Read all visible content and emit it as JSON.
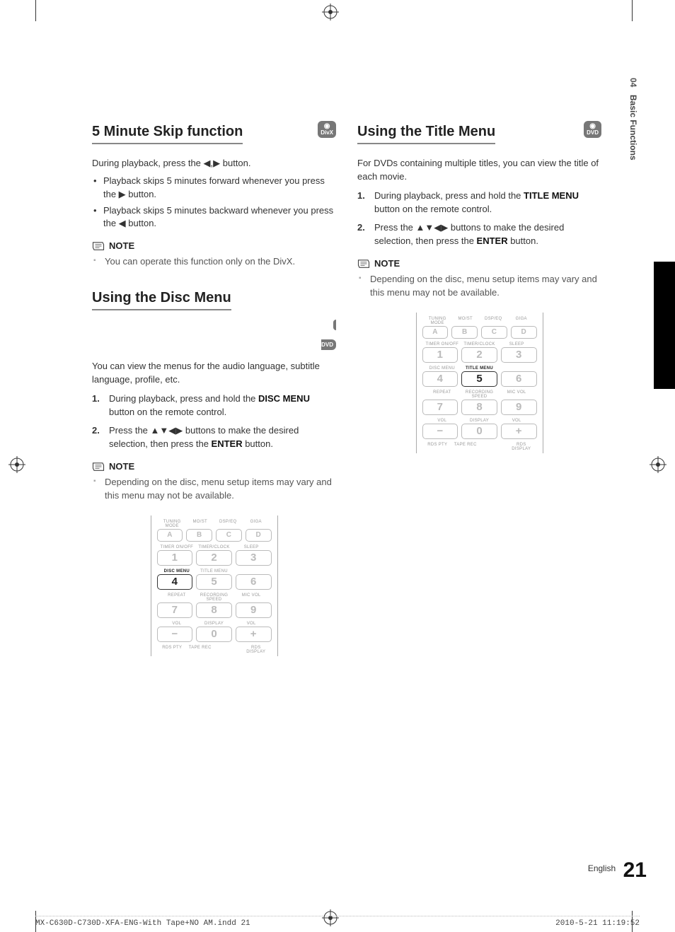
{
  "chapter": {
    "number": "04",
    "title": "Basic Functions"
  },
  "footer": {
    "language": "English",
    "page_number": "21"
  },
  "indd": {
    "file": "MX-C630D-C730D-XFA-ENG-With Tape+NO AM.indd   21",
    "timestamp": "2010-5-21   11:19:52"
  },
  "col_left": {
    "s1": {
      "heading": "5 Minute Skip function",
      "badge": "DivX",
      "intro": "During playback, press the ◀,▶ button.",
      "bullets": [
        "Playback skips 5 minutes forward whenever you press the ▶ button.",
        "Playback skips 5 minutes backward whenever you press the ◀ button."
      ],
      "note_label": "NOTE",
      "notes": [
        "You can operate this function only on the DivX."
      ]
    },
    "s2": {
      "heading": "Using the Disc Menu",
      "badge": "DVD",
      "intro": "You can view the menus for the audio language, subtitle language, profile, etc.",
      "steps": [
        {
          "n": "1.",
          "html": "During playback, press and hold the <b>DISC MENU</b> button on the remote control."
        },
        {
          "n": "2.",
          "html": "Press the ▲▼◀▶ buttons to make the desired selection, then press the <b>ENTER</b> button."
        }
      ],
      "note_label": "NOTE",
      "notes": [
        "Depending on the disc, menu setup items may vary and this menu may not be available."
      ],
      "remote_highlight": {
        "label": "DISC MENU",
        "digit": "4"
      }
    }
  },
  "col_right": {
    "s1": {
      "heading": "Using the Title Menu",
      "badge": "DVD",
      "intro": "For DVDs containing multiple titles, you can view the title of each movie.",
      "steps": [
        {
          "n": "1.",
          "html": "During playback, press and hold the <b>TITLE MENU</b> button on the remote control."
        },
        {
          "n": "2.",
          "html": "Press the ▲▼◀▶ buttons to make the desired selection, then press the <b>ENTER</b> button."
        }
      ],
      "note_label": "NOTE",
      "notes": [
        "Depending on the disc, menu setup items may vary and this menu may not be available."
      ],
      "remote_highlight": {
        "label": "TITLE MENU",
        "digit": "5"
      }
    }
  },
  "remote": {
    "row_a_labels": [
      "TUNING MODE",
      "MO/ST",
      "DSP/EQ",
      "GIGA"
    ],
    "row_a": [
      "A",
      "B",
      "C",
      "D"
    ],
    "row_1_labels": [
      "TIMER ON/OFF",
      "TIMER/CLOCK",
      "SLEEP"
    ],
    "row_1": [
      "1",
      "2",
      "3"
    ],
    "row_2_labels": [
      "DISC MENU",
      "TITLE MENU",
      ""
    ],
    "row_2": [
      "4",
      "5",
      "6"
    ],
    "row_3_labels": [
      "REPEAT",
      "RECORDING SPEED",
      "MIC VOL"
    ],
    "row_3": [
      "7",
      "8",
      "9"
    ],
    "row_4_labels": [
      "VOL",
      "DISPLAY",
      "VOL"
    ],
    "row_4": [
      "−",
      "0",
      "+"
    ],
    "row_5_labels": [
      "RDS PTY",
      "TAPE REC",
      "",
      "RDS DISPLAY"
    ]
  }
}
